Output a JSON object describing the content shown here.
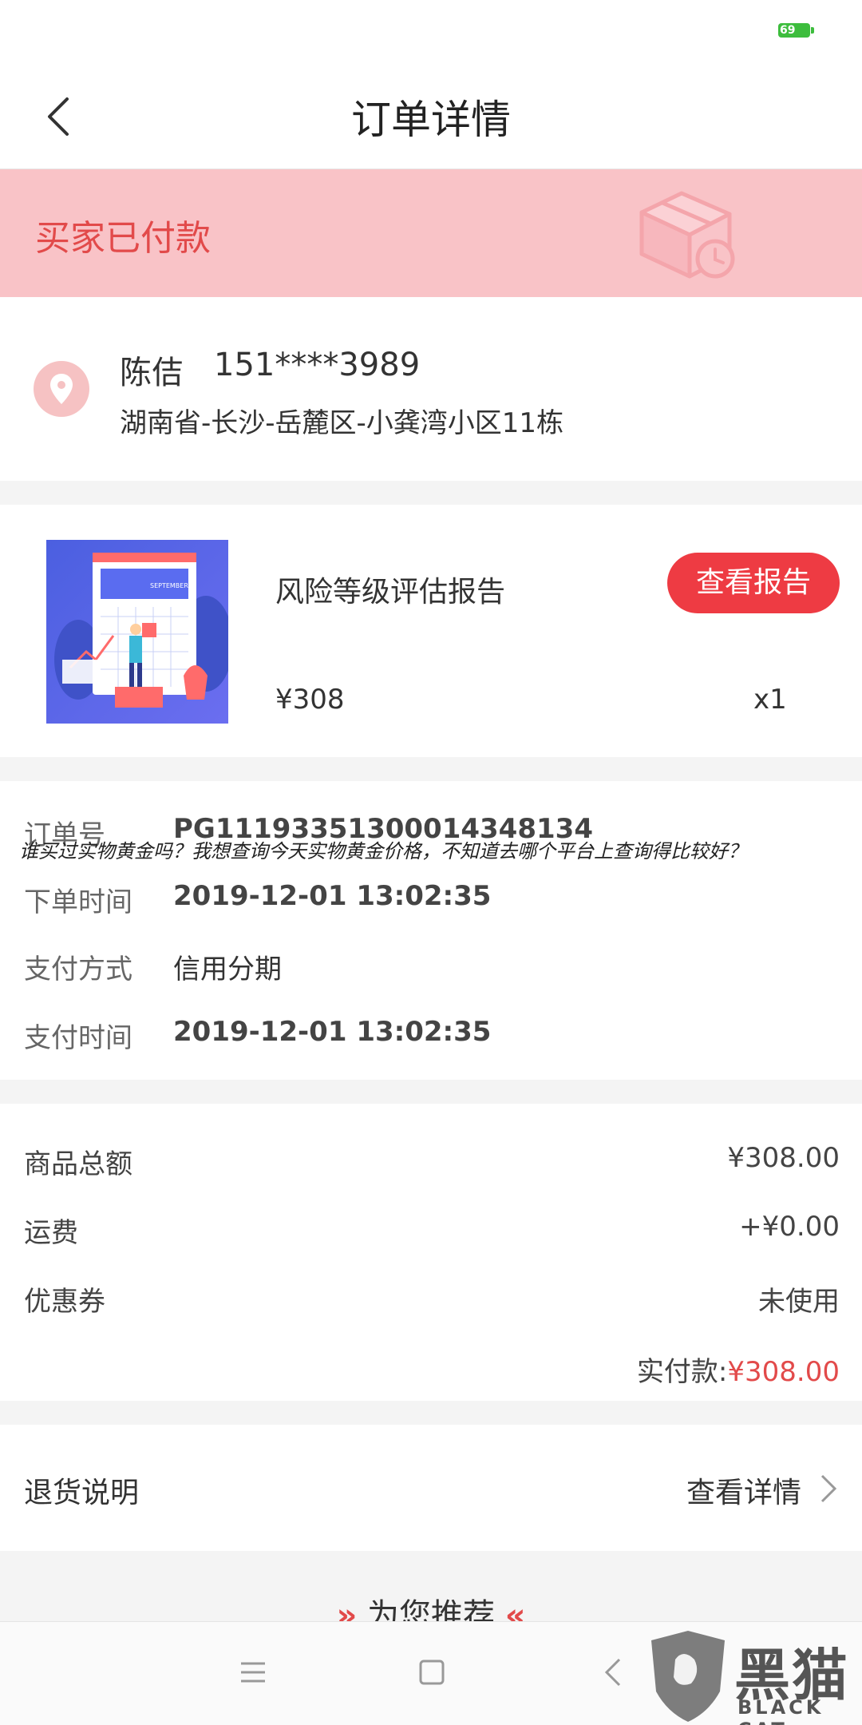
{
  "status_bar": {
    "battery": "69"
  },
  "header": {
    "title": "订单详情"
  },
  "status_banner": {
    "text": "买家已付款"
  },
  "address": {
    "name": "陈佶",
    "phone": "151****3989",
    "line": "湖南省-长沙-岳麓区-小龚湾小区11栋"
  },
  "product": {
    "name": "风险等级评估报告",
    "button": "查看报告",
    "price": "¥308",
    "quantity": "x1",
    "thumb_caption": "SEPTEMBER"
  },
  "order_info": [
    {
      "label": "订单号",
      "value": "PG11193351300014348134"
    },
    {
      "label": "下单时间",
      "value": "2019-12-01 13:02:35"
    },
    {
      "label": "支付方式",
      "value": "信用分期"
    },
    {
      "label": "支付时间",
      "value": "2019-12-01 13:02:35"
    }
  ],
  "overlay_question": "谁买过实物黄金吗？我想查询今天实物黄金价格，不知道去哪个平台上查询得比较好？",
  "totals": [
    {
      "label": "商品总额",
      "value": "¥308.00"
    },
    {
      "label": "运费",
      "value": "+¥0.00"
    },
    {
      "label": "优惠券",
      "value": "未使用"
    }
  ],
  "paid": {
    "label": "实付款:",
    "amount": "¥308.00"
  },
  "refund": {
    "label": "退货说明",
    "link": "查看详情"
  },
  "recommend": {
    "left_arrows": "»",
    "title": "为您推荐",
    "right_arrows": "«"
  },
  "watermark": {
    "cn": "黑猫",
    "en": "BLACK CAT"
  },
  "colors": {
    "accent": "#ee3b43",
    "banner_bg": "#f9c3c7",
    "banner_text": "#e24a4a"
  }
}
